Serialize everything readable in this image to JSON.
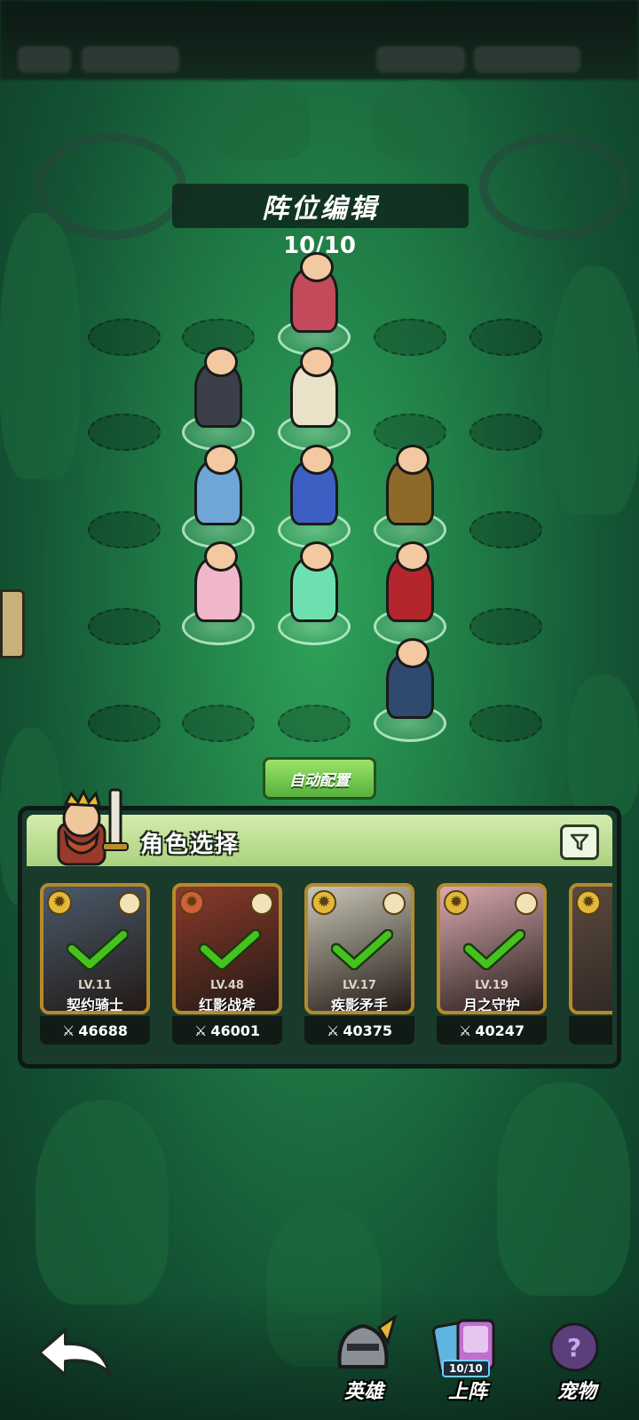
{
  "screen": {
    "header_title": "阵位编辑",
    "formation_count": "10/10"
  },
  "auto_button": {
    "label": "自动配置"
  },
  "panel": {
    "title": "角色选择",
    "cards": [
      {
        "level": "LV.11",
        "name": "契约骑士",
        "power": "46688",
        "color": "#4b5a6a",
        "selected": true
      },
      {
        "level": "LV.48",
        "name": "红影战斧",
        "power": "46001",
        "color": "#8a3a2a",
        "selected": true
      },
      {
        "level": "LV.17",
        "name": "疾影矛手",
        "power": "40375",
        "color": "#c9c6b6",
        "selected": true
      },
      {
        "level": "LV.19",
        "name": "月之守护",
        "power": "40247",
        "color": "#d9a9b0",
        "selected": true
      }
    ]
  },
  "nav": {
    "hero": "英雄",
    "formation": "上阵",
    "formation_badge": "10/10",
    "pet": "宠物"
  },
  "heroes": [
    {
      "icon": "dwarf-gunner",
      "color": "#c24a5a"
    },
    {
      "icon": "dark-mage",
      "color": "#3b3f4a"
    },
    {
      "icon": "blonde-spearman",
      "color": "#e9e1c8"
    },
    {
      "icon": "blue-monk",
      "color": "#6fa6d6"
    },
    {
      "icon": "blue-angel",
      "color": "#3d5fc4"
    },
    {
      "icon": "horned-knight",
      "color": "#8e6a2a"
    },
    {
      "icon": "moon-bunny",
      "color": "#f0b7c8"
    },
    {
      "icon": "green-skull",
      "color": "#6ee0b0"
    },
    {
      "icon": "vampire",
      "color": "#b2262c"
    },
    {
      "icon": "red-axe",
      "color": "#2f4a6e"
    }
  ],
  "colors": {
    "accent_green": "#55b13a",
    "check_green": "#46c21e",
    "card_border": "#b48a2c"
  }
}
